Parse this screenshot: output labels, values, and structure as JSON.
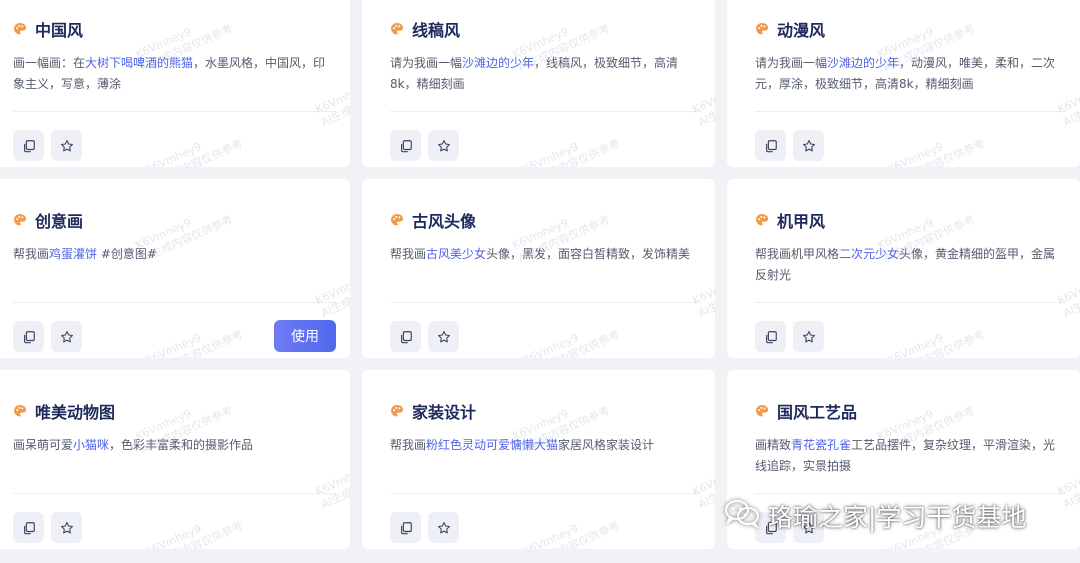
{
  "colors": {
    "page_bg": "#f1f2f6",
    "card_bg": "#ffffff",
    "title": "#1f2a5c",
    "text": "#555b6e",
    "highlight": "#4f63e8",
    "primary_button": "#5a6cf0",
    "palette_icon": "#f19a4b"
  },
  "actions": {
    "copy_icon": "copy-icon",
    "favorite_icon": "star-icon",
    "use_label": "使用"
  },
  "cards": [
    {
      "title": "中国风",
      "desc": [
        {
          "t": "画一幅画：在"
        },
        {
          "t": "大树下喝啤酒的熊猫",
          "hl": true
        },
        {
          "t": "，水墨风格，中国风，印象主义，写意，薄涂"
        }
      ],
      "show_use_button": false
    },
    {
      "title": "线稿风",
      "desc": [
        {
          "t": "请为我画一幅"
        },
        {
          "t": "沙滩边的少年",
          "hl": true
        },
        {
          "t": "，线稿风，极致细节，高清8k，精细刻画"
        }
      ],
      "show_use_button": false
    },
    {
      "title": "动漫风",
      "desc": [
        {
          "t": "请为我画一幅"
        },
        {
          "t": "沙滩边的少年",
          "hl": true
        },
        {
          "t": "，动漫风，唯美，柔和，二次元，厚涂，极致细节，高清8k，精细刻画"
        }
      ],
      "show_use_button": false
    },
    {
      "title": "创意画",
      "desc": [
        {
          "t": "帮我画"
        },
        {
          "t": "鸡蛋灌饼",
          "hl": true
        },
        {
          "t": " #创意图#"
        }
      ],
      "show_use_button": true
    },
    {
      "title": "古风头像",
      "desc": [
        {
          "t": "帮我画"
        },
        {
          "t": "古风美少女",
          "hl": true
        },
        {
          "t": "头像，黑发，面容白皙精致，发饰精美"
        }
      ],
      "show_use_button": false
    },
    {
      "title": "机甲风",
      "desc": [
        {
          "t": "帮我画机甲风格"
        },
        {
          "t": "二次元少女",
          "hl": true
        },
        {
          "t": "头像，黄金精细的盔甲，金属反射光"
        }
      ],
      "show_use_button": false
    },
    {
      "title": "唯美动物图",
      "desc": [
        {
          "t": "画呆萌可爱"
        },
        {
          "t": "小猫咪",
          "hl": true
        },
        {
          "t": "，色彩丰富柔和的摄影作品"
        }
      ],
      "show_use_button": false
    },
    {
      "title": "家装设计",
      "desc": [
        {
          "t": "帮我画"
        },
        {
          "t": "粉红色灵动可爱慵懒大猫",
          "hl": true
        },
        {
          "t": "家居风格家装设计"
        }
      ],
      "show_use_button": false
    },
    {
      "title": "国风工艺品",
      "desc": [
        {
          "t": "画精致"
        },
        {
          "t": "青花瓷孔雀",
          "hl": true
        },
        {
          "t": "工艺品摆件，复杂纹理，平滑渲染，光线追踪，实景拍摄"
        }
      ],
      "show_use_button": false
    }
  ],
  "watermark": {
    "line1": "K6Vmhey9",
    "line2": "AI生成内容仅供参考"
  },
  "brand_overlay": {
    "icon": "wechat-icon",
    "text": "珞瑜之家|学习干货基地"
  }
}
